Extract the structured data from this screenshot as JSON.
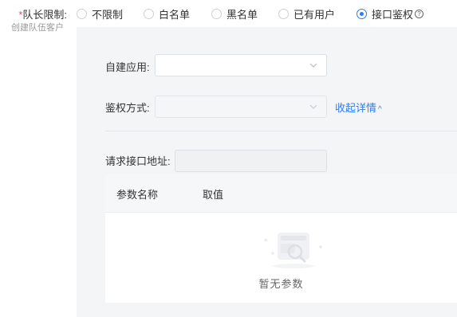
{
  "team_limit": {
    "required_mark": "*",
    "label": "队长限制:",
    "sublabel": "创建队伍客户",
    "options": [
      {
        "label": "不限制",
        "checked": false
      },
      {
        "label": "白名单",
        "checked": false
      },
      {
        "label": "黑名单",
        "checked": false
      },
      {
        "label": "已有用户",
        "checked": false
      },
      {
        "label": "接口鉴权",
        "checked": true
      }
    ],
    "help_icon": "question-circle-icon",
    "help_glyph": "?"
  },
  "config": {
    "app": {
      "label": "自建应用:",
      "value": ""
    },
    "auth_method": {
      "label": "鉴权方式:",
      "value": "",
      "disabled": true
    },
    "collapse_link": {
      "label": "收起详情",
      "caret": "^"
    },
    "request_url": {
      "label": "请求接口地址:",
      "value": ""
    },
    "params_table": {
      "columns": [
        "参数名称",
        "取值"
      ],
      "rows": [],
      "empty_text": "暂无参数",
      "empty_icon": "empty-data-icon"
    }
  },
  "colors": {
    "accent": "#2d7cf6",
    "required": "#e34d59",
    "panel_bg": "#f4f5f7"
  }
}
